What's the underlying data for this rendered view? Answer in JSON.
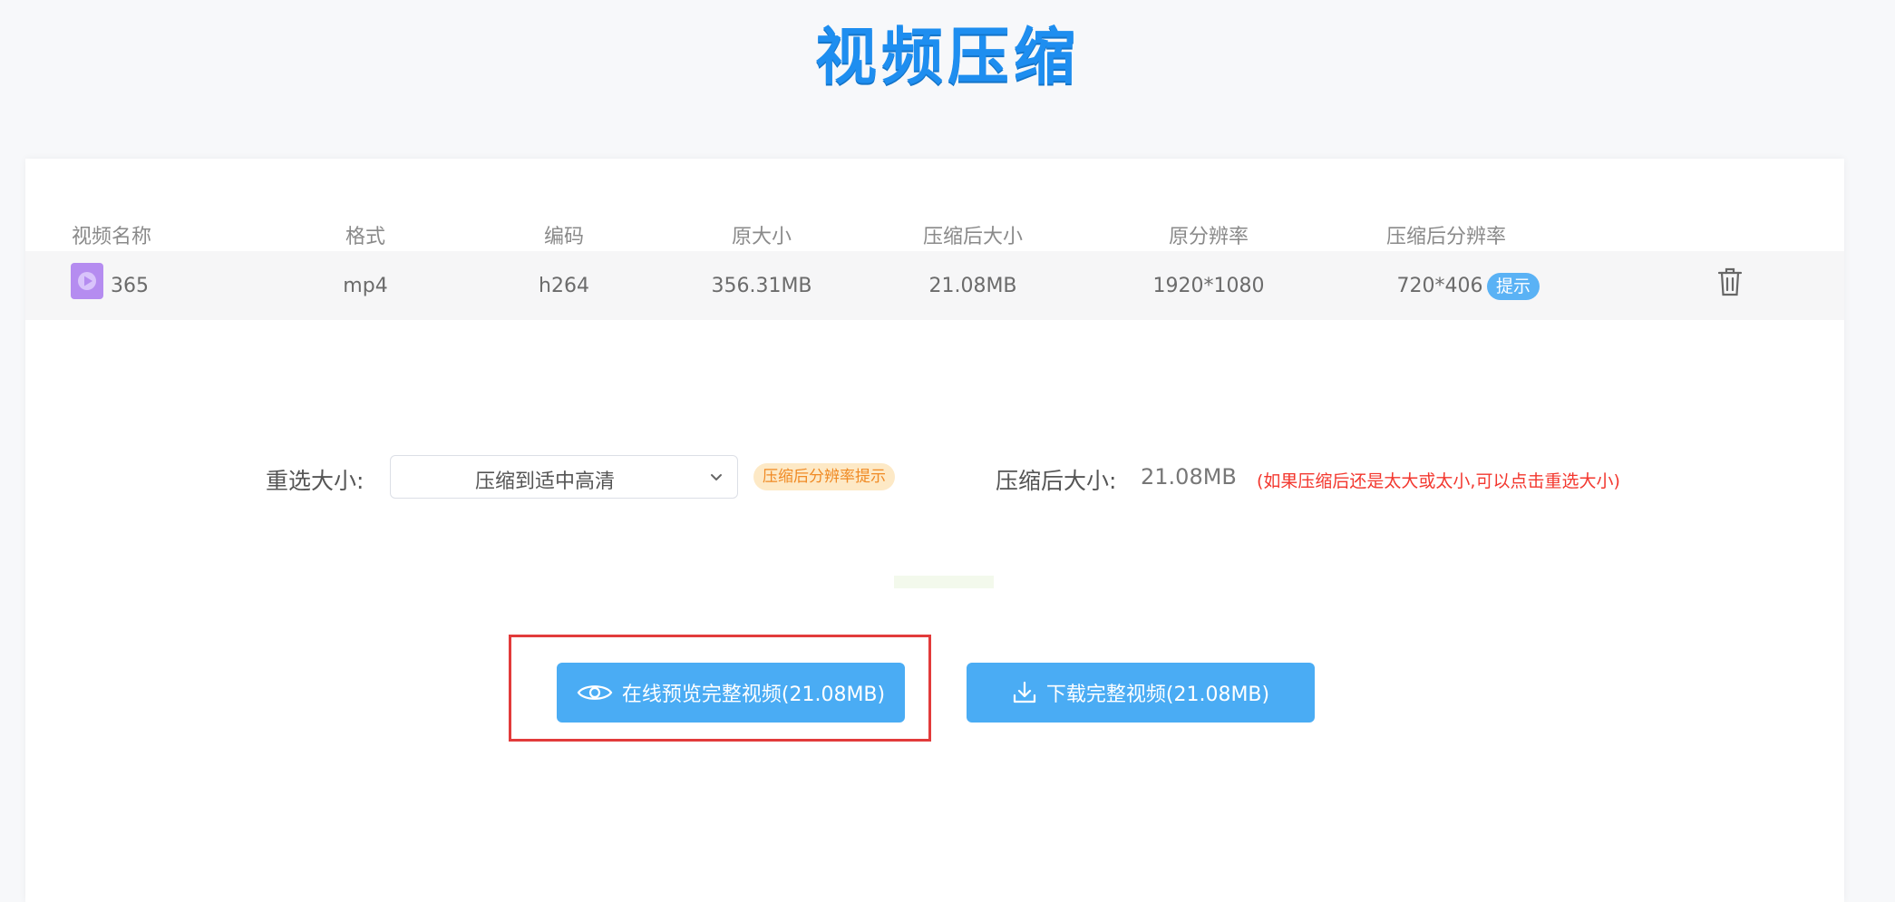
{
  "header": {
    "title": "视频压缩"
  },
  "table": {
    "columns": [
      "视频名称",
      "格式",
      "编码",
      "原大小",
      "压缩后大小",
      "原分辨率",
      "压缩后分辨率"
    ],
    "rows": [
      {
        "name": "365",
        "format": "mp4",
        "codec": "h264",
        "original_size": "356.31MB",
        "compressed_size": "21.08MB",
        "original_resolution": "1920*1080",
        "compressed_resolution": "720*406",
        "hint_label": "提示"
      }
    ]
  },
  "options": {
    "resize_label": "重选大小:",
    "select_value": "压缩到适中高清",
    "resolution_tip": "压缩后分辨率提示",
    "after_size_label": "压缩后大小:",
    "after_size_value": "21.08MB",
    "warning": "(如果压缩后还是太大或太小,可以点击重选大小)"
  },
  "actions": {
    "preview_label": "在线预览完整视频(21.08MB)",
    "download_label": "下载完整视频(21.08MB)"
  },
  "colors": {
    "title": "#1e8ef0",
    "button": "#4aacf4",
    "warning": "#f3372e",
    "highlight": "#e23b3b"
  }
}
